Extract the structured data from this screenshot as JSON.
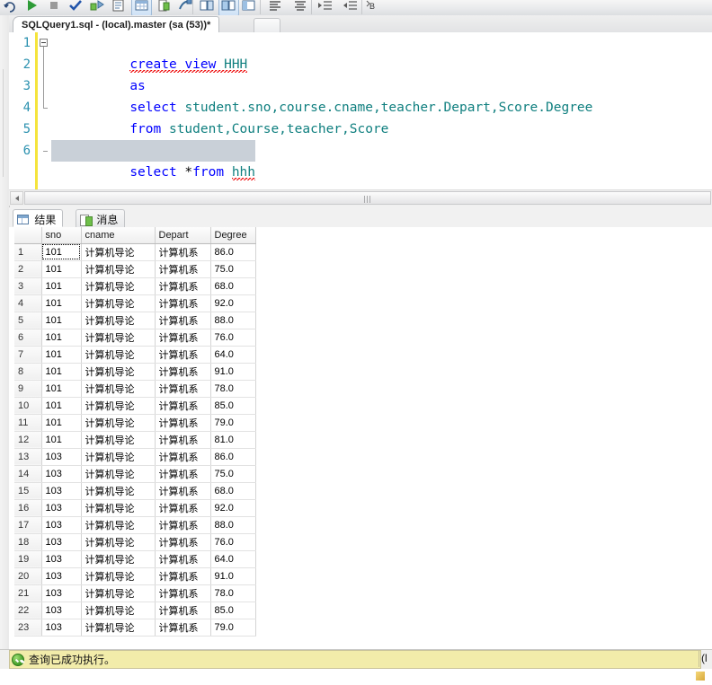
{
  "window": {
    "document_tab": "SQLQuery1.sql - (local).master (sa (53))*"
  },
  "toolbar": {
    "icons": [
      "undo-icon",
      "execute-icon",
      "stop-icon",
      "parse-check-icon",
      "display-estimated-plan-icon",
      "query-options-icon",
      "results-to-text-icon",
      "results-to-grid-icon",
      "results-to-file-icon",
      "include-actual-plan-icon",
      "comment-icon",
      "uncomment-icon",
      "indent-icon",
      "outdent-icon",
      "bookmark-icon",
      "more-icon"
    ]
  },
  "editor": {
    "line_numbers": [
      "1",
      "2",
      "3",
      "4",
      "5",
      "6"
    ],
    "lines": [
      {
        "n": 1,
        "tokens": [
          {
            "t": "create",
            "c": "kw"
          },
          {
            "t": " ",
            "c": "pl"
          },
          {
            "t": "view",
            "c": "kw"
          },
          {
            "t": " ",
            "c": "pl"
          },
          {
            "t": "HHH",
            "c": "id"
          }
        ]
      },
      {
        "n": 2,
        "tokens": [
          {
            "t": "as",
            "c": "kw"
          }
        ]
      },
      {
        "n": 3,
        "tokens": [
          {
            "t": "select",
            "c": "kw"
          },
          {
            "t": " ",
            "c": "pl"
          },
          {
            "t": "student.sno,course.cname,teacher.Depart,Score.Degree",
            "c": "id"
          }
        ]
      },
      {
        "n": 4,
        "tokens": [
          {
            "t": "from",
            "c": "kw"
          },
          {
            "t": " ",
            "c": "pl"
          },
          {
            "t": "student,Course,teacher,Score",
            "c": "id"
          }
        ]
      },
      {
        "n": 5,
        "tokens": []
      },
      {
        "n": 6,
        "tokens": [
          {
            "t": "select",
            "c": "kw"
          },
          {
            "t": " *",
            "c": "pl"
          },
          {
            "t": "from",
            "c": "kw"
          },
          {
            "t": " ",
            "c": "pl"
          },
          {
            "t": "hhh",
            "c": "id"
          }
        ]
      }
    ],
    "plain_text": [
      "create view HHH",
      "as",
      "select student.sno,course.cname,teacher.Depart,Score.Degree",
      "from student,Course,teacher,Score",
      "",
      "select *from hhh"
    ],
    "colors": {
      "keyword": "#0000ff",
      "identifier": "#0f7f7f",
      "line_number": "#2b91af",
      "change_bar": "#f5e43c",
      "selection": "#c9d0d8",
      "squiggle": "#ee0000"
    }
  },
  "results_pane": {
    "tabs": [
      {
        "label": "结果",
        "icon": "grid-icon",
        "active": true
      },
      {
        "label": "消息",
        "icon": "message-icon",
        "active": false
      }
    ],
    "columns": [
      "",
      "sno",
      "cname",
      "Depart",
      "Degree"
    ],
    "rows": [
      [
        "1",
        "101",
        "计算机导论",
        "计算机系",
        "86.0"
      ],
      [
        "2",
        "101",
        "计算机导论",
        "计算机系",
        "75.0"
      ],
      [
        "3",
        "101",
        "计算机导论",
        "计算机系",
        "68.0"
      ],
      [
        "4",
        "101",
        "计算机导论",
        "计算机系",
        "92.0"
      ],
      [
        "5",
        "101",
        "计算机导论",
        "计算机系",
        "88.0"
      ],
      [
        "6",
        "101",
        "计算机导论",
        "计算机系",
        "76.0"
      ],
      [
        "7",
        "101",
        "计算机导论",
        "计算机系",
        "64.0"
      ],
      [
        "8",
        "101",
        "计算机导论",
        "计算机系",
        "91.0"
      ],
      [
        "9",
        "101",
        "计算机导论",
        "计算机系",
        "78.0"
      ],
      [
        "10",
        "101",
        "计算机导论",
        "计算机系",
        "85.0"
      ],
      [
        "11",
        "101",
        "计算机导论",
        "计算机系",
        "79.0"
      ],
      [
        "12",
        "101",
        "计算机导论",
        "计算机系",
        "81.0"
      ],
      [
        "13",
        "103",
        "计算机导论",
        "计算机系",
        "86.0"
      ],
      [
        "14",
        "103",
        "计算机导论",
        "计算机系",
        "75.0"
      ],
      [
        "15",
        "103",
        "计算机导论",
        "计算机系",
        "68.0"
      ],
      [
        "16",
        "103",
        "计算机导论",
        "计算机系",
        "92.0"
      ],
      [
        "17",
        "103",
        "计算机导论",
        "计算机系",
        "88.0"
      ],
      [
        "18",
        "103",
        "计算机导论",
        "计算机系",
        "76.0"
      ],
      [
        "19",
        "103",
        "计算机导论",
        "计算机系",
        "64.0"
      ],
      [
        "20",
        "103",
        "计算机导论",
        "计算机系",
        "91.0"
      ],
      [
        "21",
        "103",
        "计算机导论",
        "计算机系",
        "78.0"
      ],
      [
        "22",
        "103",
        "计算机导论",
        "计算机系",
        "85.0"
      ],
      [
        "23",
        "103",
        "计算机导论",
        "计算机系",
        "79.0"
      ]
    ],
    "focused_cell": {
      "row": 0,
      "col": 1
    }
  },
  "status_bar": {
    "message": "查询已成功执行。",
    "icon": "success-check-icon",
    "right_text": "(l",
    "background": "#f2ecaa"
  }
}
